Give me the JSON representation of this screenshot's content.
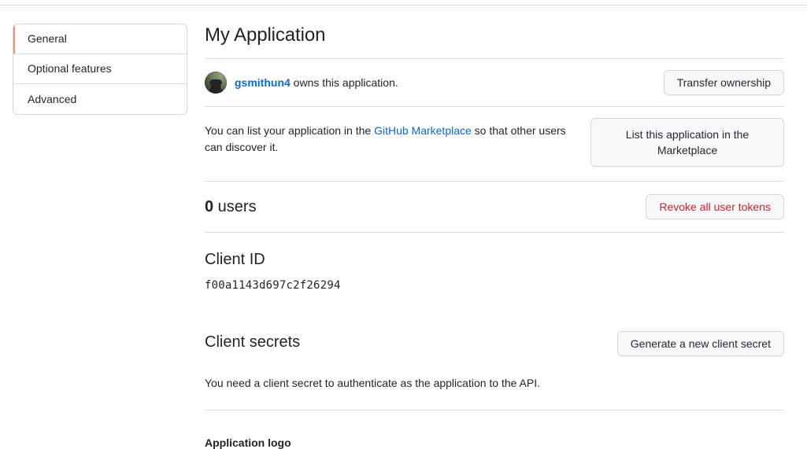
{
  "sidebar": {
    "items": [
      {
        "label": "General",
        "active": true
      },
      {
        "label": "Optional features",
        "active": false
      },
      {
        "label": "Advanced",
        "active": false
      }
    ]
  },
  "main": {
    "title": "My Application",
    "owner": {
      "avatar_alt": "gsmithun4 avatar",
      "username": "gsmithun4",
      "suffix_text": " owns this application.",
      "transfer_button": "Transfer ownership"
    },
    "marketplace": {
      "text_before": "You can list your application in the ",
      "link_text": "GitHub Marketplace",
      "text_after": " so that other users can discover it.",
      "button": "List this application in the Marketplace"
    },
    "users": {
      "count": "0",
      "label": " users",
      "revoke_button": "Revoke all user tokens"
    },
    "client_id": {
      "title": "Client ID",
      "value": "f00a1143d697c2f26294"
    },
    "client_secrets": {
      "title": "Client secrets",
      "generate_button": "Generate a new client secret",
      "description": "You need a client secret to authenticate as the application to the API."
    },
    "application_logo": {
      "label": "Application logo"
    }
  },
  "colors": {
    "accent_active": "#fd8c73",
    "link": "#0969da",
    "danger": "#cf222e",
    "border": "#d0d7de",
    "divider": "#d8dee4",
    "button_bg": "#f6f8fa",
    "text": "#1f2328"
  }
}
